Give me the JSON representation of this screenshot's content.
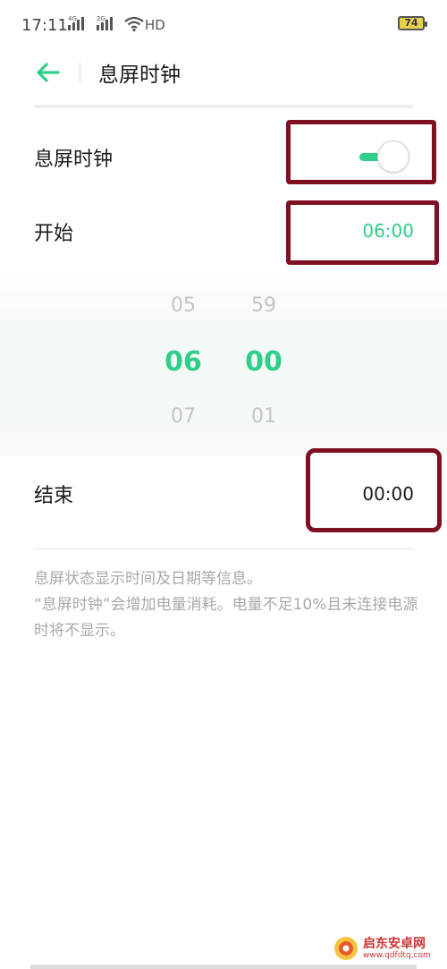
{
  "status_bar": {
    "time": "17:11",
    "signal_1_label": "4G",
    "signal_2_label": "2G",
    "hd_label": "HD",
    "battery": "74"
  },
  "header": {
    "back_icon": "arrow-left-icon",
    "title": "息屏时钟"
  },
  "settings": {
    "aod_label": "息屏时钟",
    "aod_enabled": true,
    "start_label": "开始",
    "start_value": "06:00",
    "end_label": "结束",
    "end_value": "00:00"
  },
  "time_picker": {
    "hour_prev": "05",
    "hour_selected": "06",
    "hour_next": "07",
    "minute_prev": "59",
    "minute_selected": "00",
    "minute_next": "01"
  },
  "notes": {
    "line1": "息屏状态显示时间及日期等信息。",
    "line2": "“息屏时钟”会增加电量消耗。电量不足10%且未连接电源时将不显示。"
  },
  "watermark": {
    "title": "启东安卓网",
    "url": "www.qdfdtq.com"
  },
  "colors": {
    "accent": "#2fcf8a",
    "highlight_box": "#7f1022"
  }
}
